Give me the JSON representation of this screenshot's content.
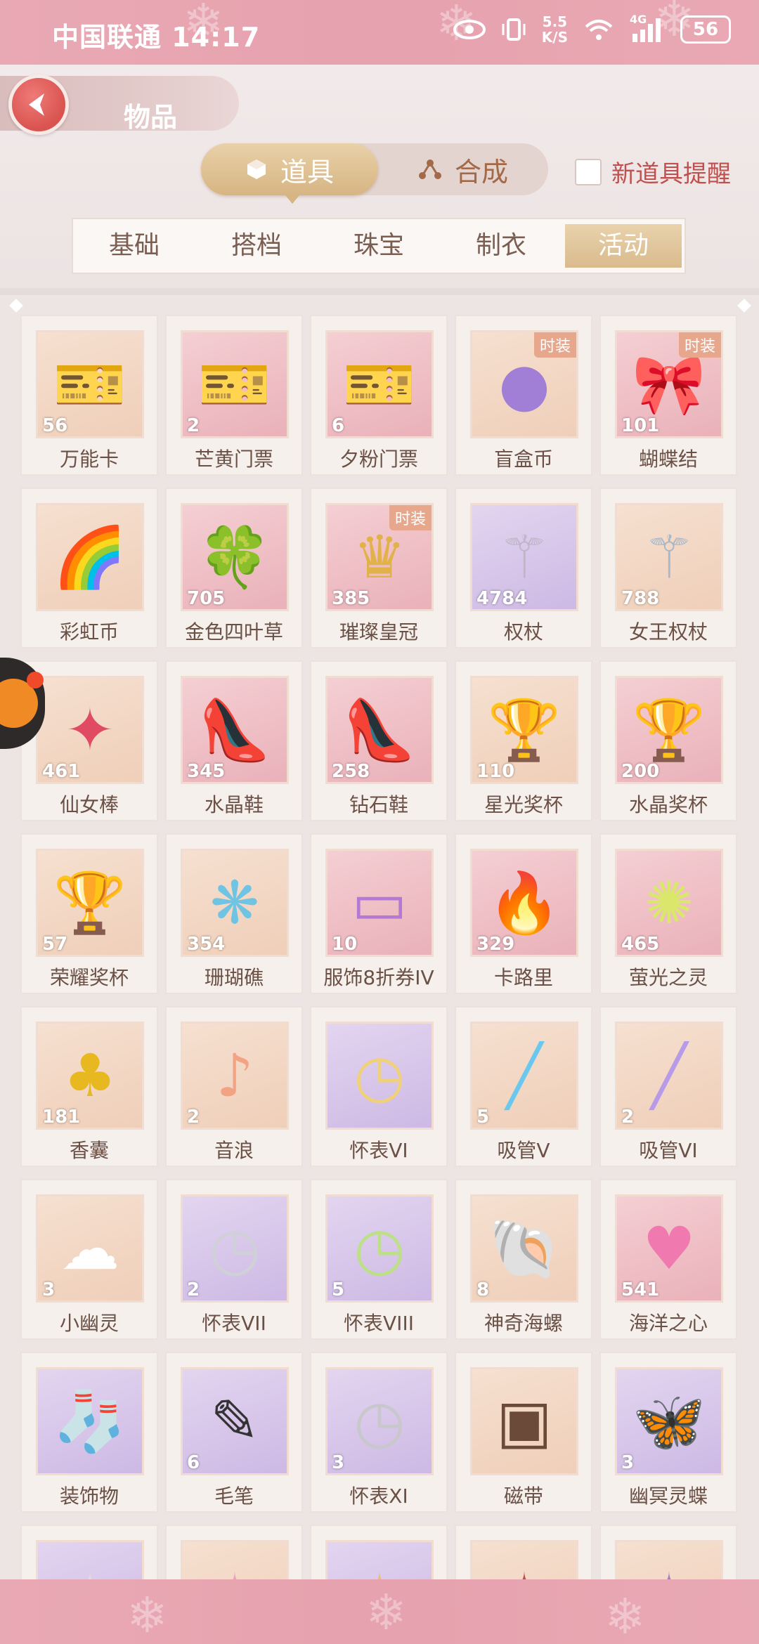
{
  "status_bar": {
    "carrier_time": "中国联通 14:17",
    "net_speed_top": "5.5",
    "net_speed_bottom": "K/S",
    "network_type": "4G",
    "battery": "56"
  },
  "header": {
    "title": "物品",
    "mode_tabs": [
      {
        "label": "道具",
        "icon": "cube-icon",
        "active": true
      },
      {
        "label": "合成",
        "icon": "nodes-icon",
        "active": false
      }
    ],
    "remind_label": "新道具提醒",
    "categories": [
      {
        "label": "基础",
        "active": false
      },
      {
        "label": "搭档",
        "active": false
      },
      {
        "label": "珠宝",
        "active": false
      },
      {
        "label": "制衣",
        "active": false
      },
      {
        "label": "活动",
        "active": true
      }
    ]
  },
  "items": [
    {
      "name": "万能卡",
      "count": "56",
      "tag": "",
      "bg": "peach",
      "icon": "ticket-icon",
      "color": "#5ec2c9"
    },
    {
      "name": "芒黄门票",
      "count": "2",
      "tag": "",
      "bg": "pink",
      "icon": "ticket-icon",
      "color": "#f2b94a"
    },
    {
      "name": "夕粉门票",
      "count": "6",
      "tag": "",
      "bg": "pink",
      "icon": "ticket-icon",
      "color": "#f2a9c0"
    },
    {
      "name": "盲盒币",
      "count": "",
      "tag": "时装",
      "bg": "peach",
      "icon": "coin-icon",
      "color": "#a27fd6"
    },
    {
      "name": "蝴蝶结",
      "count": "101",
      "tag": "时装",
      "bg": "pink",
      "icon": "bow-icon",
      "color": "#e8cf8e"
    },
    {
      "name": "彩虹币",
      "count": "",
      "tag": "",
      "bg": "peach",
      "icon": "rainbow-icon",
      "color": "#f3a04e"
    },
    {
      "name": "金色四叶草",
      "count": "705",
      "tag": "",
      "bg": "pink",
      "icon": "clover-icon",
      "color": "#f2c11a"
    },
    {
      "name": "璀璨皇冠",
      "count": "385",
      "tag": "时装",
      "bg": "pink",
      "icon": "crown-icon",
      "color": "#e2b24a"
    },
    {
      "name": "权杖",
      "count": "4784",
      "tag": "",
      "bg": "purple",
      "icon": "scepter-icon",
      "color": "#c0b6c8"
    },
    {
      "name": "女王权杖",
      "count": "788",
      "tag": "",
      "bg": "peach",
      "icon": "scepter-icon",
      "color": "#a9b8c8"
    },
    {
      "name": "仙女棒",
      "count": "461",
      "tag": "",
      "bg": "peach",
      "icon": "wand-icon",
      "color": "#e04a63"
    },
    {
      "name": "水晶鞋",
      "count": "345",
      "tag": "",
      "bg": "pink",
      "icon": "shoe-icon",
      "color": "#c7d8f2"
    },
    {
      "name": "钻石鞋",
      "count": "258",
      "tag": "",
      "bg": "pink",
      "icon": "shoe-icon",
      "color": "#d9e6f2"
    },
    {
      "name": "星光奖杯",
      "count": "110",
      "tag": "",
      "bg": "peach",
      "icon": "trophy-icon",
      "color": "#f2b21a"
    },
    {
      "name": "水晶奖杯",
      "count": "200",
      "tag": "",
      "bg": "pink",
      "icon": "trophy-icon",
      "color": "#f0c2c8"
    },
    {
      "name": "荣耀奖杯",
      "count": "57",
      "tag": "",
      "bg": "peach",
      "icon": "trophy-icon",
      "color": "#e8b83a"
    },
    {
      "name": "珊瑚礁",
      "count": "354",
      "tag": "",
      "bg": "peach",
      "icon": "coral-icon",
      "color": "#6fc3e3"
    },
    {
      "name": "服饰8折券IV",
      "count": "10",
      "tag": "",
      "bg": "pink",
      "icon": "coupon-icon",
      "color": "#b27ad4"
    },
    {
      "name": "卡路里",
      "count": "329",
      "tag": "",
      "bg": "pink",
      "icon": "flame-icon",
      "color": "#f06a4a"
    },
    {
      "name": "萤光之灵",
      "count": "465",
      "tag": "",
      "bg": "pink",
      "icon": "firefly-icon",
      "color": "#d9e86a"
    },
    {
      "name": "香囊",
      "count": "181",
      "tag": "",
      "bg": "peach",
      "icon": "pouch-icon",
      "color": "#e8b820"
    },
    {
      "name": "音浪",
      "count": "2",
      "tag": "",
      "bg": "peach",
      "icon": "music-note-icon",
      "color": "#f2a383"
    },
    {
      "name": "怀表VI",
      "count": "",
      "tag": "",
      "bg": "purple",
      "icon": "pocket-watch-icon",
      "color": "#f0d079"
    },
    {
      "name": "吸管V",
      "count": "5",
      "tag": "",
      "bg": "peach",
      "icon": "straw-icon",
      "color": "#6ac8ee"
    },
    {
      "name": "吸管VI",
      "count": "2",
      "tag": "",
      "bg": "peach",
      "icon": "straw-icon",
      "color": "#b79be8"
    },
    {
      "name": "小幽灵",
      "count": "3",
      "tag": "",
      "bg": "peach",
      "icon": "ghost-icon",
      "color": "#ffffff"
    },
    {
      "name": "怀表VII",
      "count": "2",
      "tag": "",
      "bg": "purple",
      "icon": "pocket-watch-icon",
      "color": "#d0d0d8"
    },
    {
      "name": "怀表VIII",
      "count": "5",
      "tag": "",
      "bg": "purple",
      "icon": "pocket-watch-icon",
      "color": "#bde086"
    },
    {
      "name": "神奇海螺",
      "count": "8",
      "tag": "",
      "bg": "peach",
      "icon": "shell-icon",
      "color": "#f2c9d3"
    },
    {
      "name": "海洋之心",
      "count": "541",
      "tag": "",
      "bg": "pink",
      "icon": "heart-icon",
      "color": "#f07ab0"
    },
    {
      "name": "装饰物",
      "count": "",
      "tag": "",
      "bg": "purple",
      "icon": "stocking-icon",
      "color": "#e05050"
    },
    {
      "name": "毛笔",
      "count": "6",
      "tag": "",
      "bg": "purple",
      "icon": "brush-icon",
      "color": "#333333"
    },
    {
      "name": "怀表XI",
      "count": "3",
      "tag": "",
      "bg": "purple",
      "icon": "pocket-watch-icon",
      "color": "#c8c8cc"
    },
    {
      "name": "磁带",
      "count": "",
      "tag": "",
      "bg": "peach",
      "icon": "cassette-icon",
      "color": "#6b4a3a"
    },
    {
      "name": "幽冥灵蝶",
      "count": "3",
      "tag": "",
      "bg": "purple",
      "icon": "butterfly-icon",
      "color": "#8a4ad4"
    },
    {
      "name": "",
      "count": "",
      "tag": "",
      "bg": "purple",
      "icon": "partial-item-icon",
      "color": "#dddddd"
    },
    {
      "name": "",
      "count": "",
      "tag": "",
      "bg": "peach",
      "icon": "partial-item-icon",
      "color": "#f0a0c0"
    },
    {
      "name": "",
      "count": "",
      "tag": "",
      "bg": "purple",
      "icon": "partial-item-icon",
      "color": "#e8c070"
    },
    {
      "name": "",
      "count": "",
      "tag": "",
      "bg": "peach",
      "icon": "partial-item-icon",
      "color": "#c05050"
    },
    {
      "name": "",
      "count": "",
      "tag": "",
      "bg": "peach",
      "icon": "partial-item-icon",
      "color": "#a080c0"
    }
  ]
}
